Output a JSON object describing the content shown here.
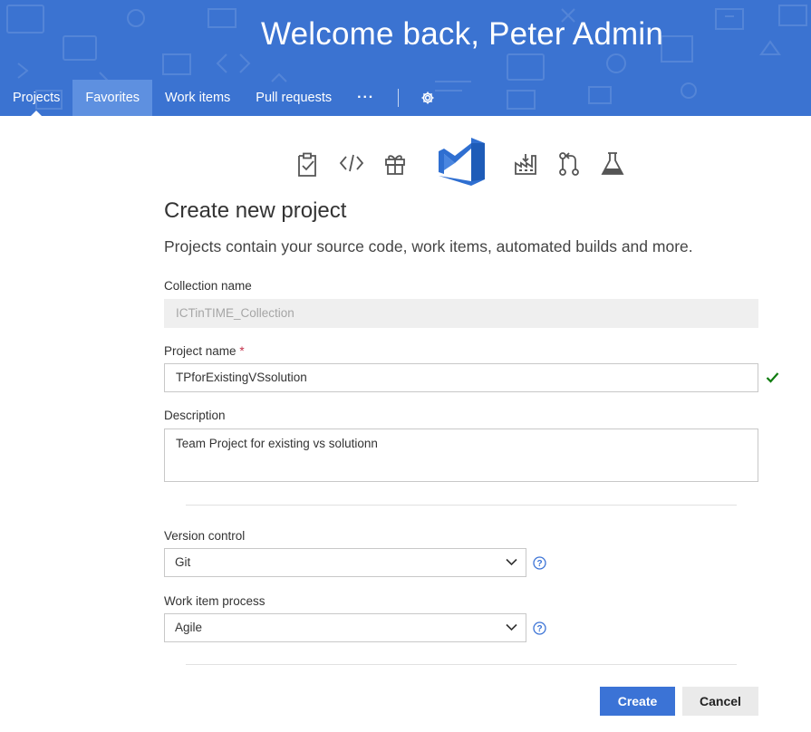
{
  "header": {
    "welcome": "Welcome back, Peter Admin",
    "nav": [
      {
        "label": "Projects"
      },
      {
        "label": "Favorites"
      },
      {
        "label": "Work items"
      },
      {
        "label": "Pull requests"
      }
    ],
    "more_label": "···",
    "bg_color": "#3b73d1"
  },
  "icons": [
    "work-items-icon",
    "code-icon",
    "gift-icon",
    "visual-studio-logo-icon",
    "build-icon",
    "pull-request-icon",
    "test-flask-icon"
  ],
  "form": {
    "title": "Create new project",
    "subtitle": "Projects contain your source code, work items, automated builds and more.",
    "collection": {
      "label": "Collection name",
      "value": "ICTinTIME_Collection"
    },
    "project_name": {
      "label": "Project name",
      "required": "*",
      "value": "TPforExistingVSsolution"
    },
    "description": {
      "label": "Description",
      "value": "Team Project for existing vs solutionn"
    },
    "version_control": {
      "label": "Version control",
      "value": "Git"
    },
    "work_item_process": {
      "label": "Work item process",
      "value": "Agile"
    }
  },
  "buttons": {
    "create": "Create",
    "cancel": "Cancel"
  },
  "colors": {
    "accent": "#3b73d6",
    "success": "#107c10"
  }
}
